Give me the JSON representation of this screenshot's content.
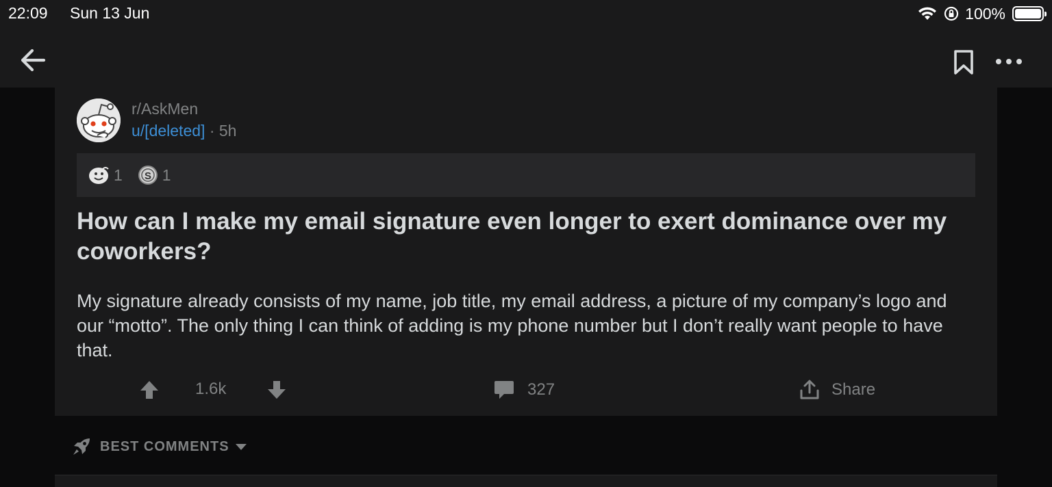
{
  "status_bar": {
    "time": "22:09",
    "date": "Sun 13 Jun",
    "battery": "100%",
    "battery_level": 1.0
  },
  "nav": {
    "back_icon": "arrow-left-icon",
    "bookmark_icon": "bookmark-icon",
    "more_icon": "more-horizontal-icon"
  },
  "post": {
    "subreddit": "r/AskMen",
    "author": "u/[deleted]",
    "separator": "·",
    "age": "5h",
    "awards": [
      {
        "icon": "wholesome-award-icon",
        "count": "1"
      },
      {
        "icon": "silver-coin-award-icon",
        "count": "1"
      }
    ],
    "title": "How can I make my email signature even longer to exert dominance over my coworkers?",
    "body": "My signature already consists of my name, job title, my email address, a picture of my company’s logo and our “motto”. The only thing I can think of adding is my phone number but I don’t really want people to have that.",
    "score": "1.6k",
    "comment_count": "327",
    "share_label": "Share"
  },
  "comments_sort": {
    "label": "BEST COMMENTS"
  },
  "colors": {
    "background": "#0b0b0c",
    "card": "#1a1a1b",
    "award_bar": "#272729",
    "text": "#d7dadc",
    "muted": "#818384",
    "username": "#3d8fd6"
  }
}
